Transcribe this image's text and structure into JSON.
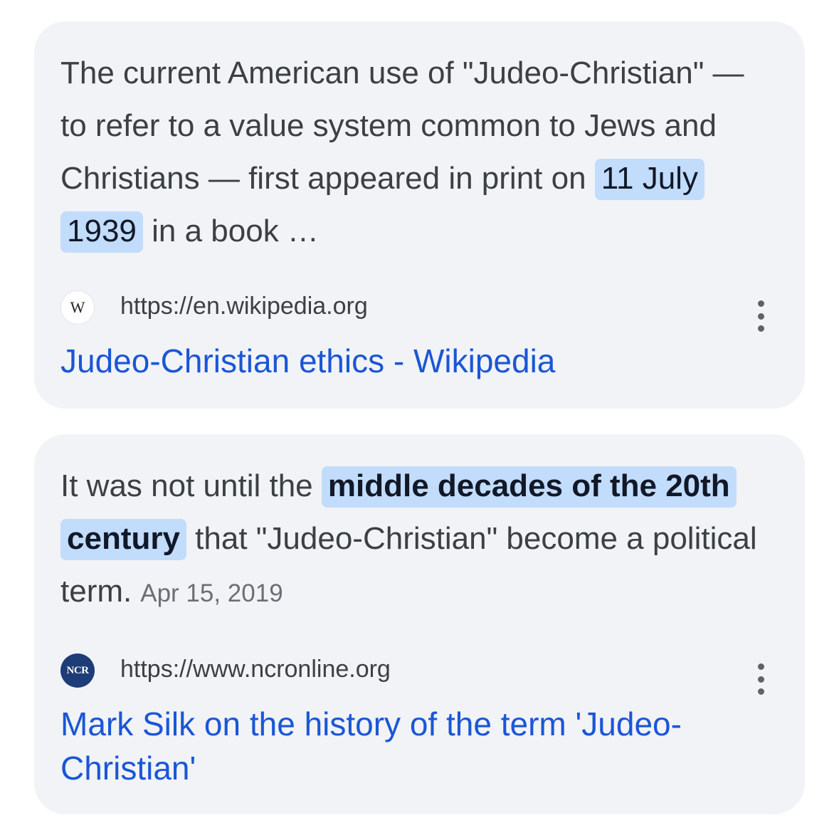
{
  "results": [
    {
      "snippet_before": "The current American use of \"Judeo-Christian\" — to refer to a value system common to Jews and Christians — first appeared in print on ",
      "snippet_highlight": "11 July 1939",
      "snippet_after": " in a book …",
      "date": "",
      "favicon_text": "W",
      "favicon_icon": "wikipedia-favicon",
      "url": "https://en.wikipedia.org",
      "title": "Judeo-Christian ethics - Wikipedia"
    },
    {
      "snippet_before": "It was not until the ",
      "snippet_highlight": "middle decades of the 20th century",
      "snippet_after": " that \"Judeo-Christian\" become a political term.",
      "date": "Apr 15, 2019",
      "favicon_text": "NCR",
      "favicon_icon": "ncr-favicon",
      "url": "https://www.ncronline.org",
      "title": "Mark Silk on the history of the term 'Judeo-Christian'"
    }
  ],
  "colors": {
    "card_background": "#f1f3f6",
    "highlight": "#c2dcfb",
    "link": "#1a56d6",
    "text": "#3c4043"
  }
}
